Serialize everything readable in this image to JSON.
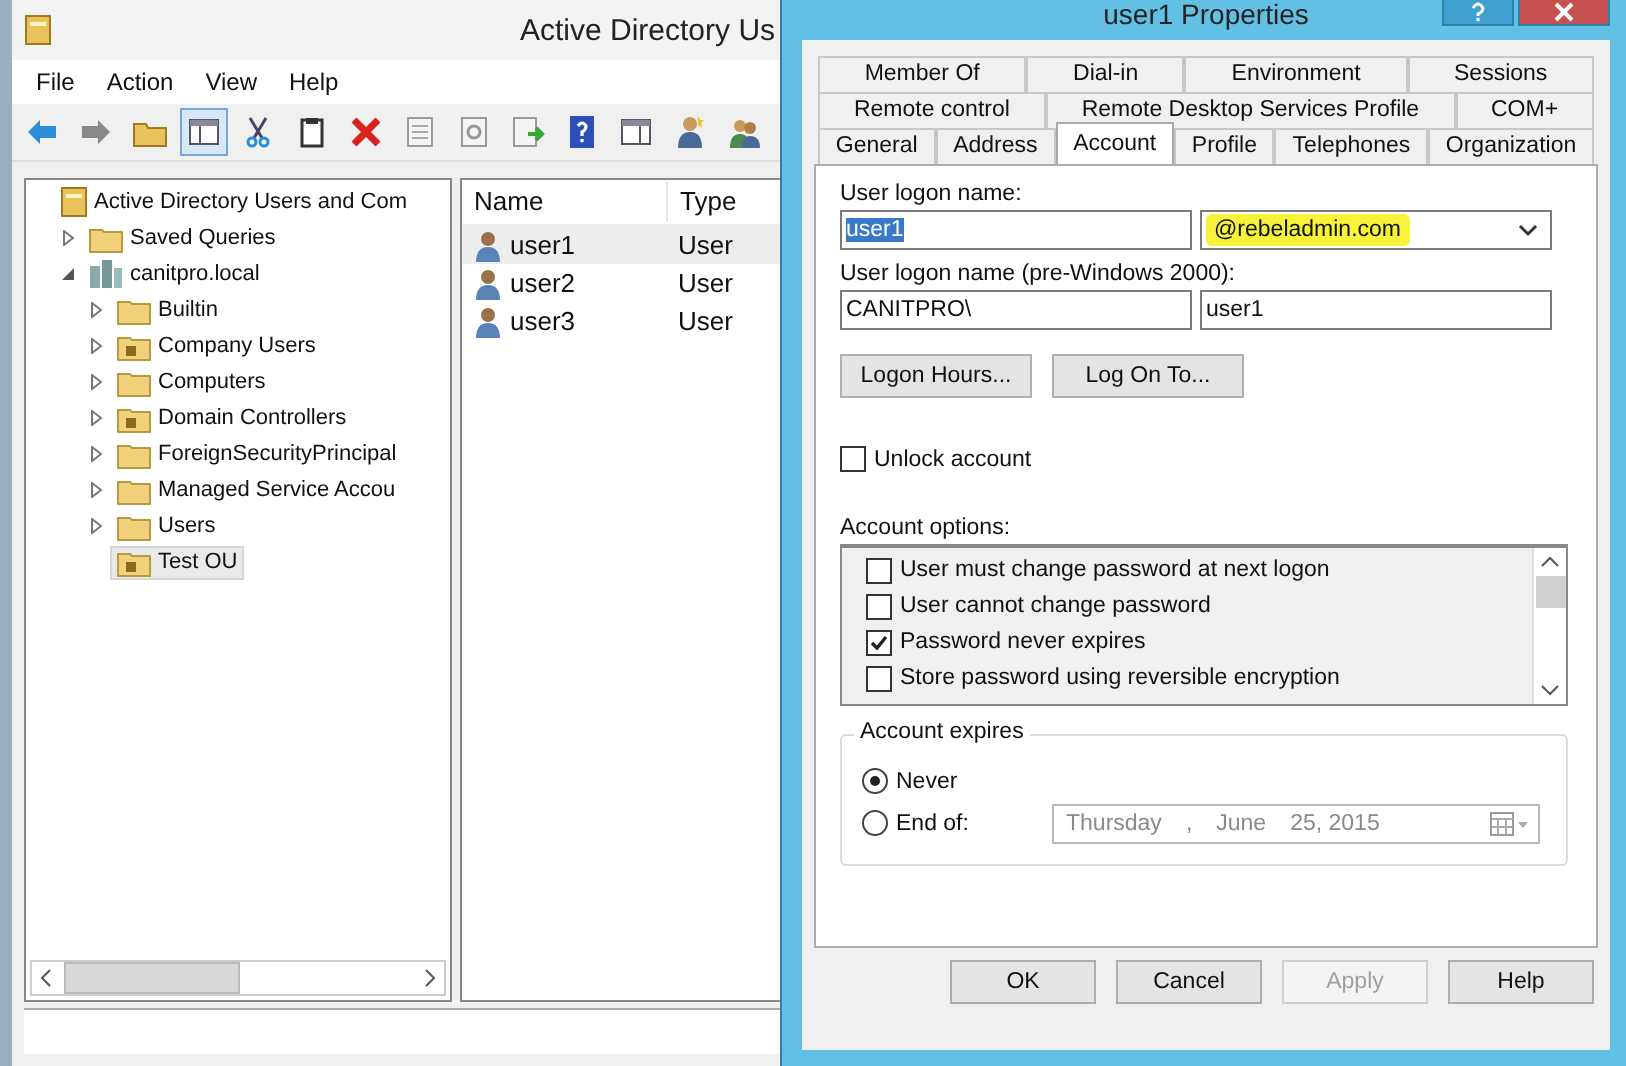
{
  "main_window": {
    "title": "Active Directory Us",
    "menu": [
      "File",
      "Action",
      "View",
      "Help"
    ],
    "tree": [
      {
        "label": "Active Directory Users and Com",
        "kind": "root",
        "selected": false,
        "children": [
          {
            "label": "Saved Queries",
            "kind": "folder",
            "expanded": false,
            "selected": false
          },
          {
            "label": "canitpro.local",
            "kind": "domain",
            "expanded": true,
            "selected": false,
            "children": [
              {
                "label": "Builtin",
                "kind": "folder",
                "expanded": false,
                "selected": false
              },
              {
                "label": "Company Users",
                "kind": "ou",
                "expanded": false,
                "selected": false
              },
              {
                "label": "Computers",
                "kind": "folder",
                "expanded": false,
                "selected": false
              },
              {
                "label": "Domain Controllers",
                "kind": "ou",
                "expanded": false,
                "selected": false
              },
              {
                "label": "ForeignSecurityPrincipal",
                "kind": "folder",
                "expanded": false,
                "selected": false
              },
              {
                "label": "Managed Service Accou",
                "kind": "folder",
                "expanded": false,
                "selected": false
              },
              {
                "label": "Users",
                "kind": "folder",
                "expanded": false,
                "selected": false
              },
              {
                "label": "Test OU",
                "kind": "ou",
                "selected": true
              }
            ]
          }
        ]
      }
    ],
    "list": {
      "columns": [
        "Name",
        "Type"
      ],
      "rows": [
        {
          "name": "user1",
          "type": "User",
          "selected": true
        },
        {
          "name": "user2",
          "type": "User",
          "selected": false
        },
        {
          "name": "user3",
          "type": "User",
          "selected": false
        }
      ]
    }
  },
  "dialog": {
    "title": "user1 Properties",
    "tab_rows": [
      [
        {
          "label": "Member Of",
          "selected": false
        },
        {
          "label": "Dial-in",
          "selected": false
        },
        {
          "label": "Environment",
          "selected": false
        },
        {
          "label": "Sessions",
          "selected": false
        }
      ],
      [
        {
          "label": "Remote control",
          "selected": false
        },
        {
          "label": "Remote Desktop Services Profile",
          "selected": false
        },
        {
          "label": "COM+",
          "selected": false
        }
      ],
      [
        {
          "label": "General",
          "selected": false
        },
        {
          "label": "Address",
          "selected": false
        },
        {
          "label": "Account",
          "selected": true
        },
        {
          "label": "Profile",
          "selected": false
        },
        {
          "label": "Telephones",
          "selected": false
        },
        {
          "label": "Organization",
          "selected": false
        }
      ]
    ],
    "logon_name": {
      "label": "User logon name:",
      "value": "user1",
      "domain": "@rebeladmin.com"
    },
    "pre2000_name": {
      "label": "User logon name (pre-Windows 2000):",
      "domain": "CANITPRO\\",
      "value": "user1"
    },
    "logon_buttons": [
      "Logon Hours...",
      "Log On To..."
    ],
    "unlock": {
      "label": "Unlock account",
      "checked": false
    },
    "account_options": {
      "label": "Account options:",
      "items": [
        {
          "label": "User must change password at next logon",
          "checked": false
        },
        {
          "label": "User cannot change password",
          "checked": false
        },
        {
          "label": "Password never expires",
          "checked": true
        },
        {
          "label": "Store password using reversible encryption",
          "checked": false
        }
      ]
    },
    "account_expires": {
      "label": "Account expires",
      "options": [
        {
          "label": "Never",
          "selected": true
        },
        {
          "label": "End of:",
          "selected": false
        }
      ],
      "date": {
        "parts": [
          "Thursday",
          ",",
          "June",
          "25, 2015"
        ],
        "disabled": true
      }
    },
    "buttons": [
      {
        "label": "OK",
        "disabled": false
      },
      {
        "label": "Cancel",
        "disabled": false
      },
      {
        "label": "Apply",
        "disabled": true
      },
      {
        "label": "Help",
        "disabled": false
      }
    ]
  }
}
